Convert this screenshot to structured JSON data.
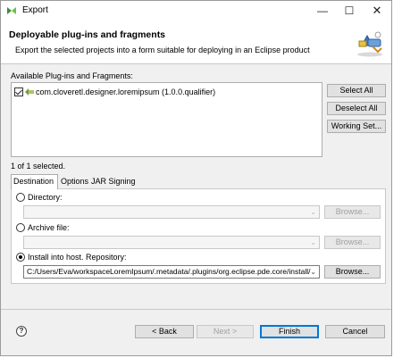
{
  "window": {
    "title": "Export",
    "icons": {
      "app": "eclipse-icon",
      "minimize": "minimize-icon",
      "maximize": "maximize-icon",
      "close": "close-icon"
    }
  },
  "header": {
    "title": "Deployable plug-ins and fragments",
    "description": "Export the selected projects into a form suitable for deploying in an Eclipse product",
    "icon": "plugin-export-icon"
  },
  "plugins": {
    "label": "Available Plug-ins and Fragments:",
    "items": [
      {
        "label": "com.cloveretl.designer.loremipsum (1.0.0.qualifier)",
        "checked": true,
        "icon": "plugin-icon"
      }
    ],
    "buttons": {
      "select_all": "Select All",
      "deselect_all": "Deselect All",
      "working_set": "Working Set..."
    },
    "selected_text": "1 of 1 selected."
  },
  "tabs": [
    {
      "label": "Destination",
      "active": true
    },
    {
      "label": "Options",
      "active": false
    },
    {
      "label": "JAR Signing",
      "active": false
    }
  ],
  "destination": {
    "directory": {
      "label": "Directory:",
      "value": "",
      "browse": "Browse...",
      "checked": false
    },
    "archive": {
      "label": "Archive file:",
      "value": "",
      "browse": "Browse...",
      "checked": false
    },
    "install": {
      "label": "Install into host. Repository:",
      "value": "C:/Users/Eva/workspaceLoremIpsum/.metadata/.plugins/org.eclipse.pde.core/install/",
      "browse": "Browse...",
      "checked": true
    }
  },
  "footer": {
    "help_icon": "help-icon",
    "help_symbol": "?",
    "back": "< Back",
    "next": "Next >",
    "finish": "Finish",
    "cancel": "Cancel"
  },
  "colors": {
    "accent": "#0078d7",
    "disabled_text": "#a0a0a0"
  }
}
